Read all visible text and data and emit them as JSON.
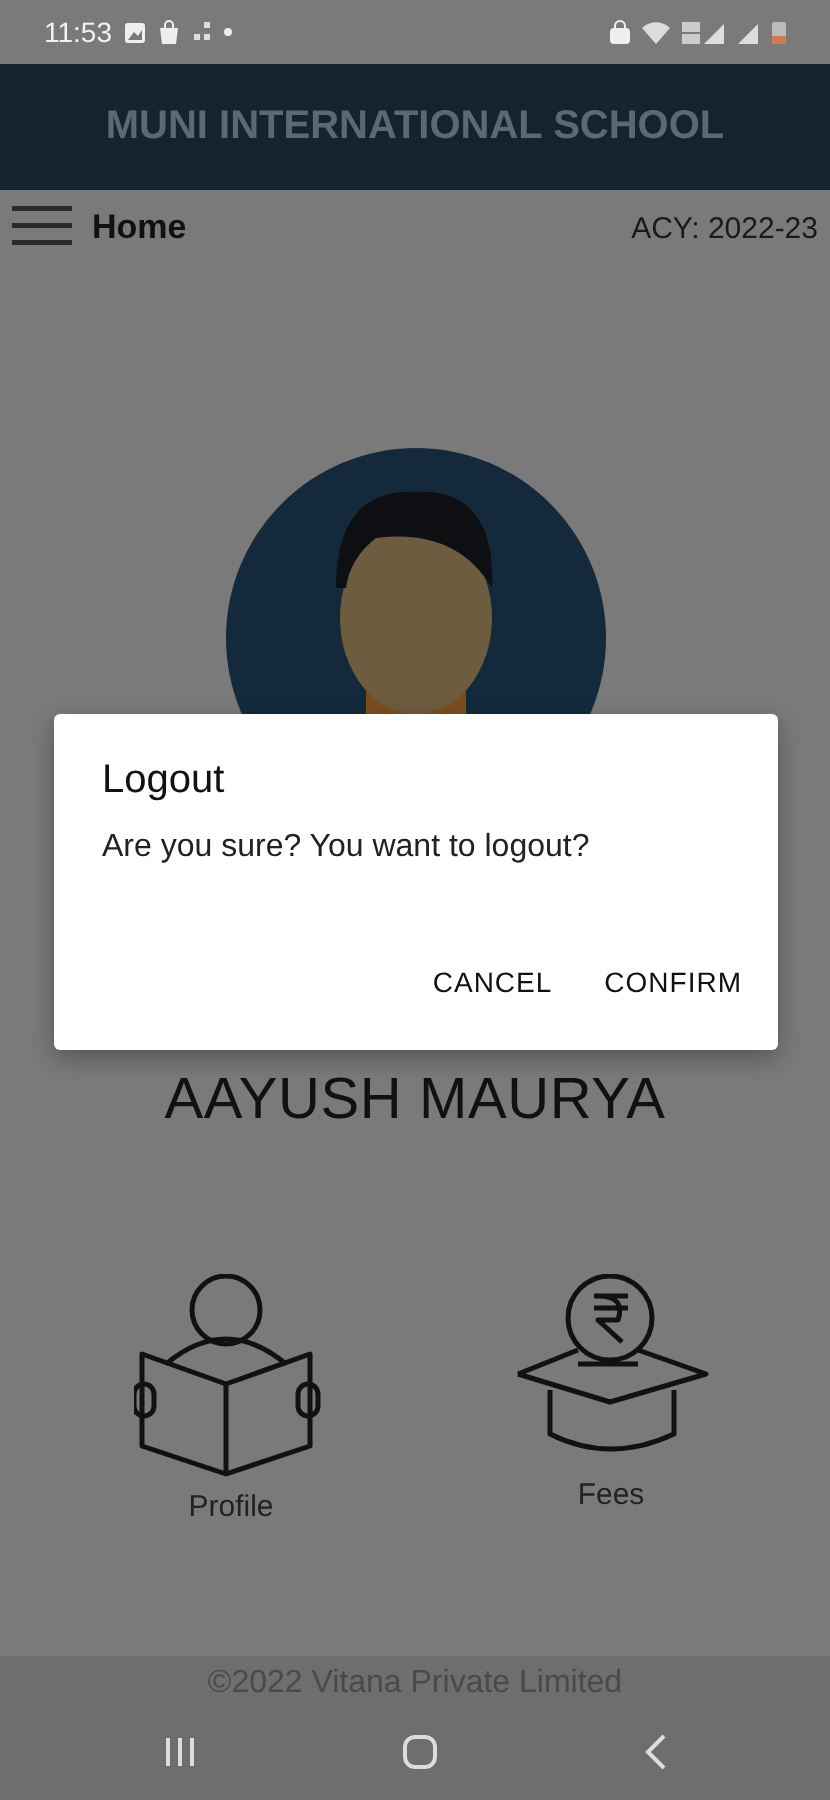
{
  "status_bar": {
    "time": "11:53"
  },
  "header": {
    "title": "MUNI INTERNATIONAL SCHOOL"
  },
  "toolbar": {
    "title": "Home",
    "academic_year": "ACY: 2022-23"
  },
  "profile": {
    "name": "AAYUSH MAURYA"
  },
  "tiles": [
    {
      "label": "Profile",
      "kind": "reader"
    },
    {
      "label": "Fees",
      "kind": "fees"
    }
  ],
  "footer": {
    "text": "©2022 Vitana Private Limited"
  },
  "dialog": {
    "title": "Logout",
    "message": "Are you sure? You want to logout?",
    "buttons": [
      "CANCEL",
      "CONFIRM"
    ]
  }
}
